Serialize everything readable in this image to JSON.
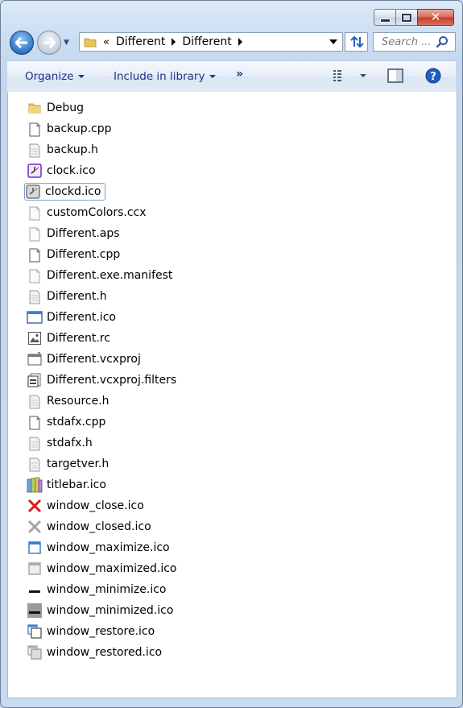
{
  "window": {
    "caption_buttons": {
      "minimize": "minimize",
      "maximize": "maximize",
      "close": "close"
    }
  },
  "nav": {
    "breadcrumb_overflow": "«",
    "breadcrumbs": [
      "Different",
      "Different"
    ],
    "search_placeholder": "Search ..."
  },
  "toolbar": {
    "organize_label": "Organize",
    "include_label": "Include in library",
    "more_label": "»"
  },
  "files": [
    {
      "name": "Debug",
      "icon": "folder-icon"
    },
    {
      "name": "backup.cpp",
      "icon": "cpp-file-icon"
    },
    {
      "name": "backup.h",
      "icon": "header-file-icon"
    },
    {
      "name": "clock.ico",
      "icon": "clock-icon"
    },
    {
      "name": "clockd.ico",
      "icon": "clock-disabled-icon"
    },
    {
      "name": "customColors.ccx",
      "icon": "blank-file-icon"
    },
    {
      "name": "Different.aps",
      "icon": "blank-file-icon"
    },
    {
      "name": "Different.cpp",
      "icon": "cpp-file-icon"
    },
    {
      "name": "Different.exe.manifest",
      "icon": "blank-file-icon"
    },
    {
      "name": "Different.h",
      "icon": "header-file-icon"
    },
    {
      "name": "Different.ico",
      "icon": "window-ico-icon"
    },
    {
      "name": "Different.rc",
      "icon": "resource-file-icon"
    },
    {
      "name": "Different.vcxproj",
      "icon": "vcxproj-file-icon"
    },
    {
      "name": "Different.vcxproj.filters",
      "icon": "filters-file-icon"
    },
    {
      "name": "Resource.h",
      "icon": "header-file-icon"
    },
    {
      "name": "stdafx.cpp",
      "icon": "cpp-file-icon"
    },
    {
      "name": "stdafx.h",
      "icon": "header-file-icon"
    },
    {
      "name": "targetver.h",
      "icon": "header-file-icon"
    },
    {
      "name": "titlebar.ico",
      "icon": "titlebar-icon"
    },
    {
      "name": "window_close.ico",
      "icon": "close-x-icon"
    },
    {
      "name": "window_closed.ico",
      "icon": "close-x-disabled-icon"
    },
    {
      "name": "window_maximize.ico",
      "icon": "maximize-icon"
    },
    {
      "name": "window_maximized.ico",
      "icon": "maximized-icon"
    },
    {
      "name": "window_minimize.ico",
      "icon": "minimize-icon"
    },
    {
      "name": "window_minimized.ico",
      "icon": "minimized-icon"
    },
    {
      "name": "window_restore.ico",
      "icon": "restore-icon"
    },
    {
      "name": "window_restored.ico",
      "icon": "restored-icon"
    }
  ],
  "focused_index": 4,
  "colors": {
    "accent": "#1e3287",
    "close_red": "#c43c28",
    "selection_border": "#7da2ce"
  }
}
